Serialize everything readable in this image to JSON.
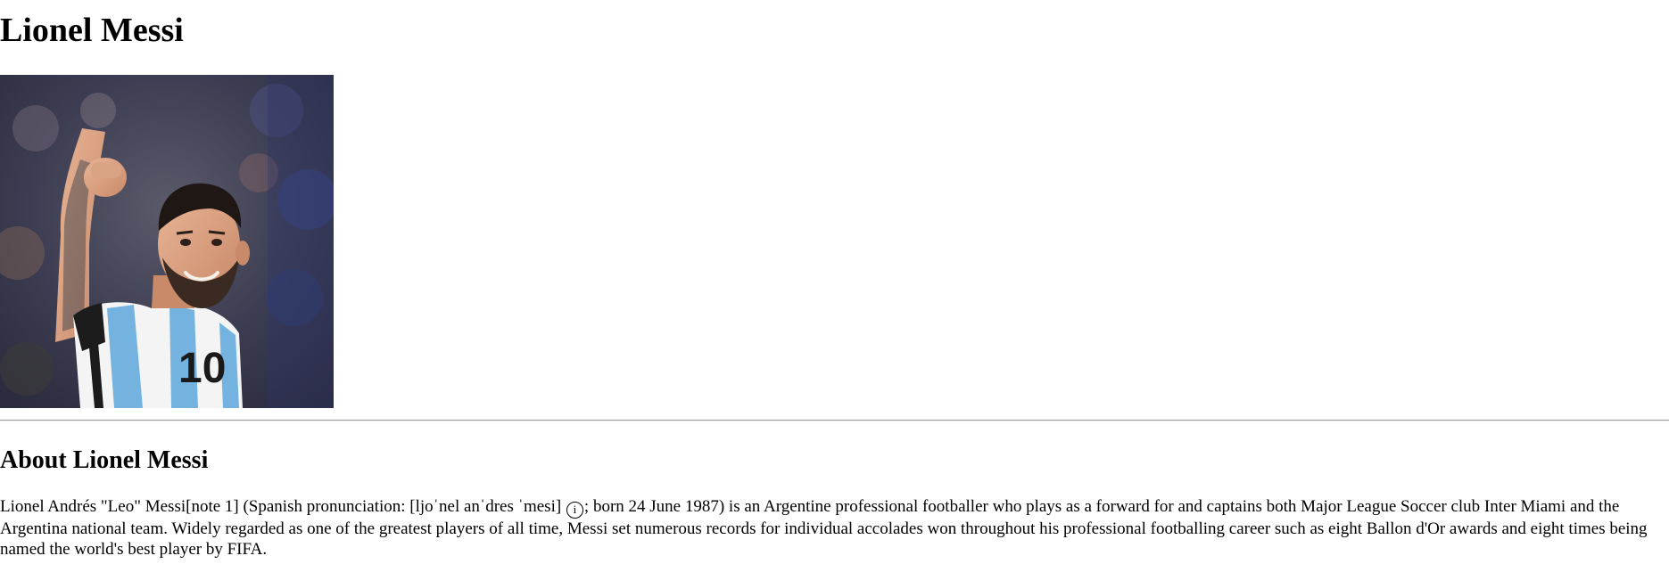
{
  "page": {
    "title": "Lionel Messi",
    "image_alt": "Lionel Messi celebrating in an Argentina number 10 shirt"
  },
  "about": {
    "heading": "About Lionel Messi",
    "bio_before_icon": "Lionel Andrés \"Leo\" Messi[note 1] (Spanish pronunciation: [ljoˈnel anˈdres ˈmesi]",
    "audio_icon_glyph": "i",
    "bio_after_icon": "; born 24 June 1987) is an Argentine professional footballer who plays as a forward for and captains both Major League Soccer club Inter Miami and the Argentina national team. Widely regarded as one of the greatest players of all time, Messi set numerous records for individual accolades won throughout his professional footballing career such as eight Ballon d'Or awards and eight times being named the world's best player by FIFA."
  },
  "icons": {
    "audio": "audio-info-icon"
  },
  "colors": {
    "text": "#000000",
    "background": "#ffffff",
    "divider": "#9a9a9a",
    "jersey_blue": "#74b3e0"
  }
}
